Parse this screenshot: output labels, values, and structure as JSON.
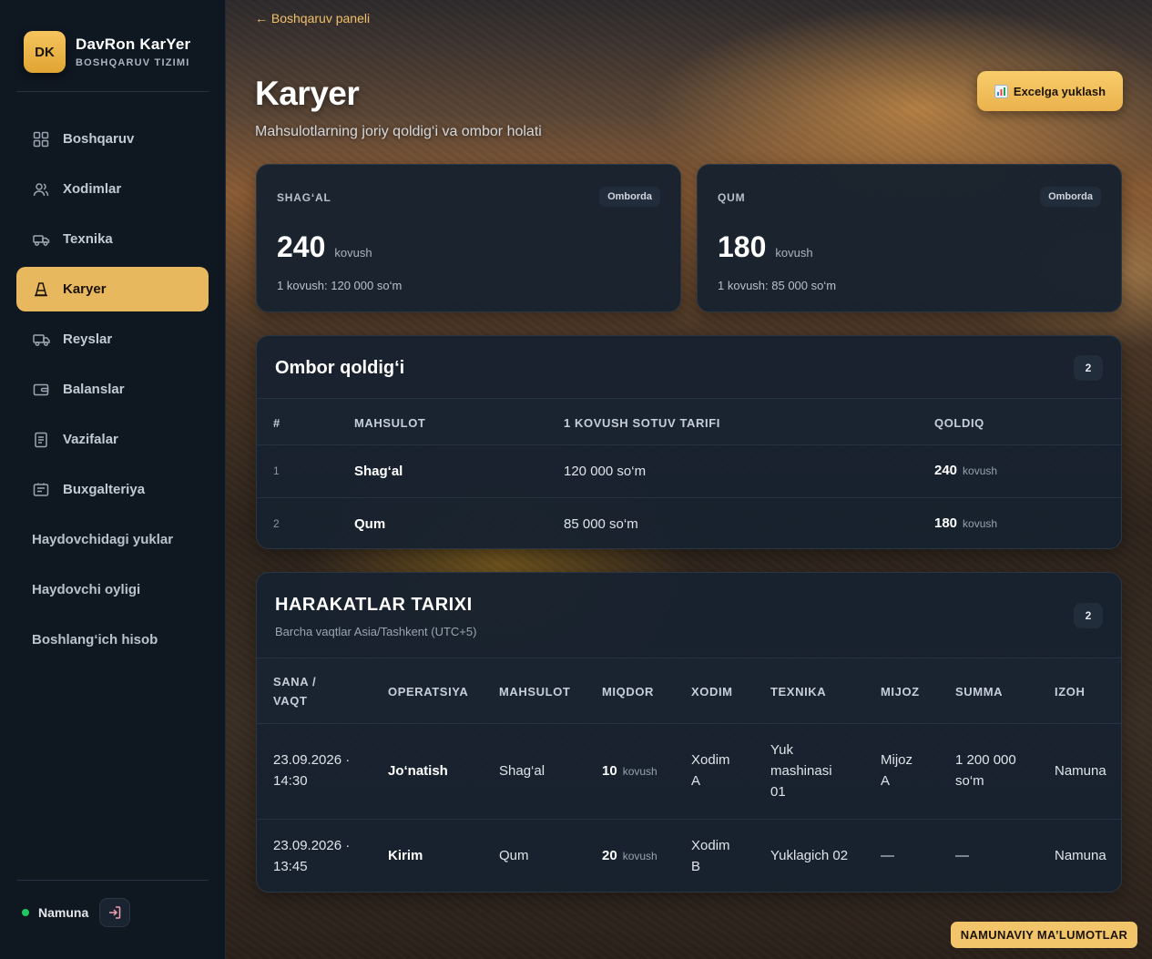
{
  "brand": {
    "initials": "DK",
    "name": "DavRon KarYer",
    "subtitle": "BOSHQARUV TIZIMI"
  },
  "sidebar": {
    "items": [
      {
        "label": "Boshqaruv",
        "icon": "grid-icon"
      },
      {
        "label": "Xodimlar",
        "icon": "users-icon"
      },
      {
        "label": "Texnika",
        "icon": "truck-icon"
      },
      {
        "label": "Karyer",
        "icon": "cone-icon",
        "active": true
      },
      {
        "label": "Reyslar",
        "icon": "truck-icon"
      },
      {
        "label": "Balanslar",
        "icon": "wallet-icon"
      },
      {
        "label": "Vazifalar",
        "icon": "document-icon"
      },
      {
        "label": "Buxgalteriya",
        "icon": "ledger-icon"
      },
      {
        "label": "Haydovchidagi yuklar"
      },
      {
        "label": "Haydovchi oyligi"
      },
      {
        "label": "Boshlang‘ich hisob"
      }
    ],
    "user": {
      "name": "Namuna",
      "status_color": "#22c55e"
    }
  },
  "header": {
    "back_link": "← Boshqaruv paneli",
    "title": "Karyer",
    "subtitle": "Mahsulotlarning joriy qoldig‘i va ombor holati",
    "export_button": "Excelga yuklash"
  },
  "stats": [
    {
      "label": "SHAG‘AL",
      "badge": "Omborda",
      "value": "240",
      "unit": "kovush",
      "price": "1 kovush: 120 000 so‘m"
    },
    {
      "label": "QUM",
      "badge": "Omborda",
      "value": "180",
      "unit": "kovush",
      "price": "1 kovush: 85 000 so‘m"
    }
  ],
  "stock": {
    "title": "Ombor qoldig‘i",
    "count": "2",
    "columns": [
      "#",
      "MAHSULOT",
      "1 KOVUSH SOTUV TARIFI",
      "QOLDIQ"
    ],
    "rows": [
      {
        "num": "1",
        "product": "Shag‘al",
        "price": "120 000 so‘m",
        "qty": "240",
        "unit": "kovush"
      },
      {
        "num": "2",
        "product": "Qum",
        "price": "85 000 so‘m",
        "qty": "180",
        "unit": "kovush"
      }
    ]
  },
  "history": {
    "title": "HARAKATLAR TARIXI",
    "subtitle": "Barcha vaqtlar Asia/Tashkent (UTC+5)",
    "count": "2",
    "columns": {
      "date_l1": "SANA /",
      "date_l2": "VAQT",
      "operation": "OPERATSIYA",
      "product": "MAHSULOT",
      "amount": "MIQDOR",
      "employee": "XODIM",
      "machine": "TEXNIKA",
      "client": "MIJOZ",
      "sum": "SUMMA",
      "note": "IZOH"
    },
    "rows": [
      {
        "date_l1": "23.09.2026 ·",
        "date_l2": "14:30",
        "operation": "Jo‘natish",
        "product": "Shag‘al",
        "qty": "10",
        "unit": "kovush",
        "employee_l1": "Xodim",
        "employee_l2": "A",
        "machine_l1": "Yuk",
        "machine_l2": "mashinasi",
        "machine_l3": "01",
        "client_l1": "Mijoz",
        "client_l2": "A",
        "sum_l1": "1 200 000",
        "sum_l2": "so‘m",
        "note": "Namuna"
      },
      {
        "date_l1": "23.09.2026 ·",
        "date_l2": "13:45",
        "operation": "Kirim",
        "product": "Qum",
        "qty": "20",
        "unit": "kovush",
        "employee_l1": "Xodim",
        "employee_l2": "B",
        "machine": "Yuklagich 02",
        "client": "—",
        "sum": "—",
        "note": "Namuna"
      }
    ]
  },
  "demo_badge": "NAMUNAVIY MA’LUMOTLAR",
  "colors": {
    "accent": "#e8b85e",
    "sidebar_bg": "#0f1721",
    "card_bg": "#18222e"
  }
}
